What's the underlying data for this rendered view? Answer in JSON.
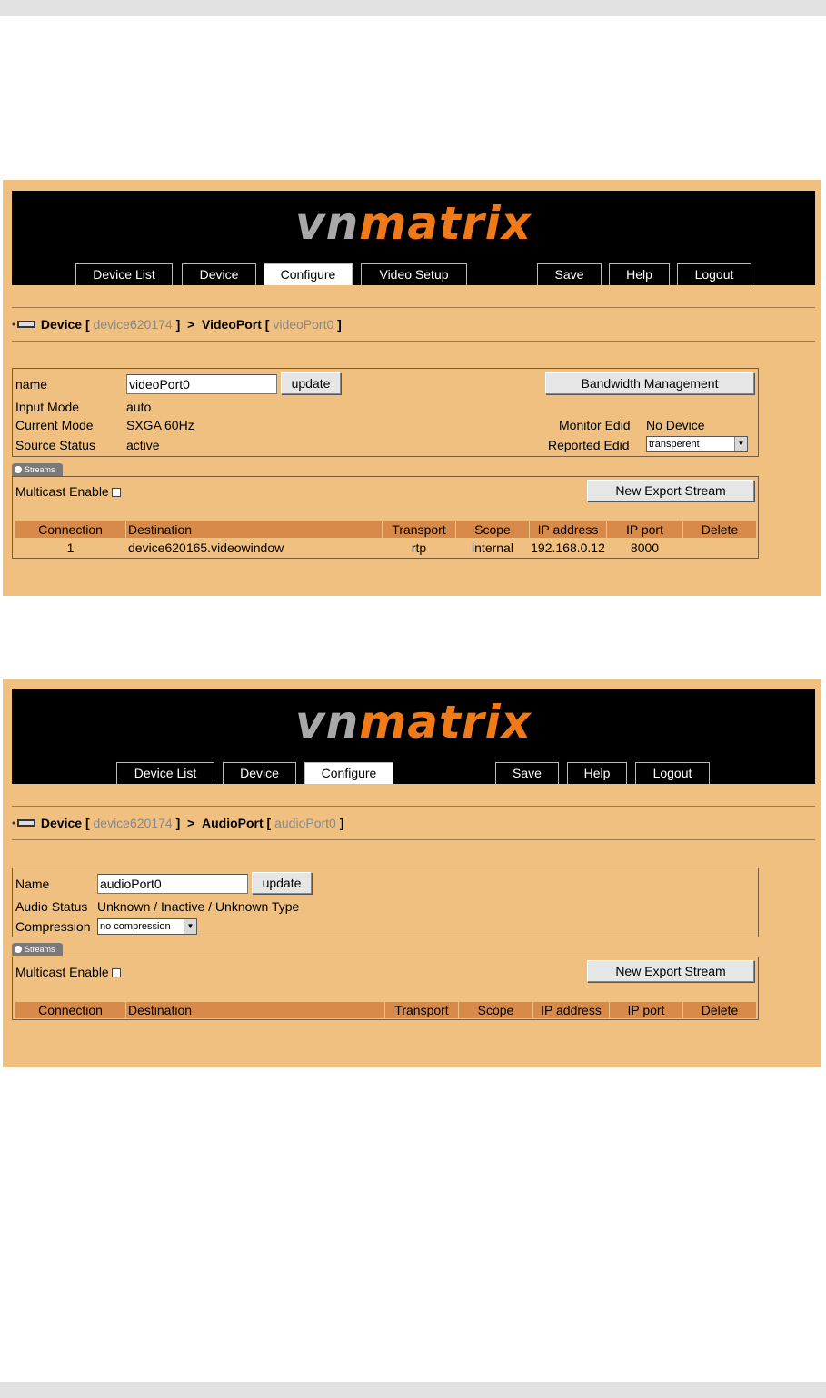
{
  "screen1": {
    "logo": {
      "vn": "vn",
      "matrix": "matrix"
    },
    "tabs": [
      "Device List",
      "Device",
      "Configure",
      "Video Setup",
      "Save",
      "Help",
      "Logout"
    ],
    "active_tab": "Configure",
    "breadcrumb": {
      "device_label": "Device",
      "device_name": "device620174",
      "port_label": "VideoPort",
      "port_name": "videoPort0"
    },
    "form": {
      "name_label": "name",
      "name_value": "videoPort0",
      "update_label": "update",
      "bandwidth_label": "Bandwidth Management",
      "input_mode_label": "Input Mode",
      "input_mode_value": "auto",
      "current_mode_label": "Current Mode",
      "current_mode_value": "SXGA 60Hz",
      "source_status_label": "Source Status",
      "source_status_value": "active",
      "monitor_edid_label": "Monitor Edid",
      "monitor_edid_value": "No Device",
      "reported_edid_label": "Reported Edid",
      "reported_edid_value": "transperent"
    },
    "streams": {
      "tab_label": "Streams",
      "multicast_label": "Multicast Enable",
      "new_export_label": "New Export Stream",
      "columns": [
        "Connection",
        "Destination",
        "Transport",
        "Scope",
        "IP address",
        "IP port",
        "Delete"
      ],
      "rows": [
        {
          "connection": "1",
          "destination": "device620165.videowindow",
          "transport": "rtp",
          "scope": "internal",
          "ip": "192.168.0.12",
          "port": "8000"
        }
      ]
    }
  },
  "screen2": {
    "logo": {
      "vn": "vn",
      "matrix": "matrix"
    },
    "tabs": [
      "Device List",
      "Device",
      "Configure",
      "Save",
      "Help",
      "Logout"
    ],
    "active_tab": "Configure",
    "breadcrumb": {
      "device_label": "Device",
      "device_name": "device620174",
      "port_label": "AudioPort",
      "port_name": "audioPort0"
    },
    "form": {
      "name_label": "Name",
      "name_value": "audioPort0",
      "update_label": "update",
      "audio_status_label": "Audio Status",
      "audio_status_value": "Unknown / Inactive / Unknown Type",
      "compression_label": "Compression",
      "compression_value": "no compression"
    },
    "streams": {
      "tab_label": "Streams",
      "multicast_label": "Multicast Enable",
      "new_export_label": "New Export Stream",
      "columns": [
        "Connection",
        "Destination",
        "Transport",
        "Scope",
        "IP address",
        "IP port",
        "Delete"
      ]
    }
  },
  "colors": {
    "panel": "#f0c080",
    "header": "#000000",
    "accent": "#f07a18",
    "table_header": "#d88a4a"
  }
}
